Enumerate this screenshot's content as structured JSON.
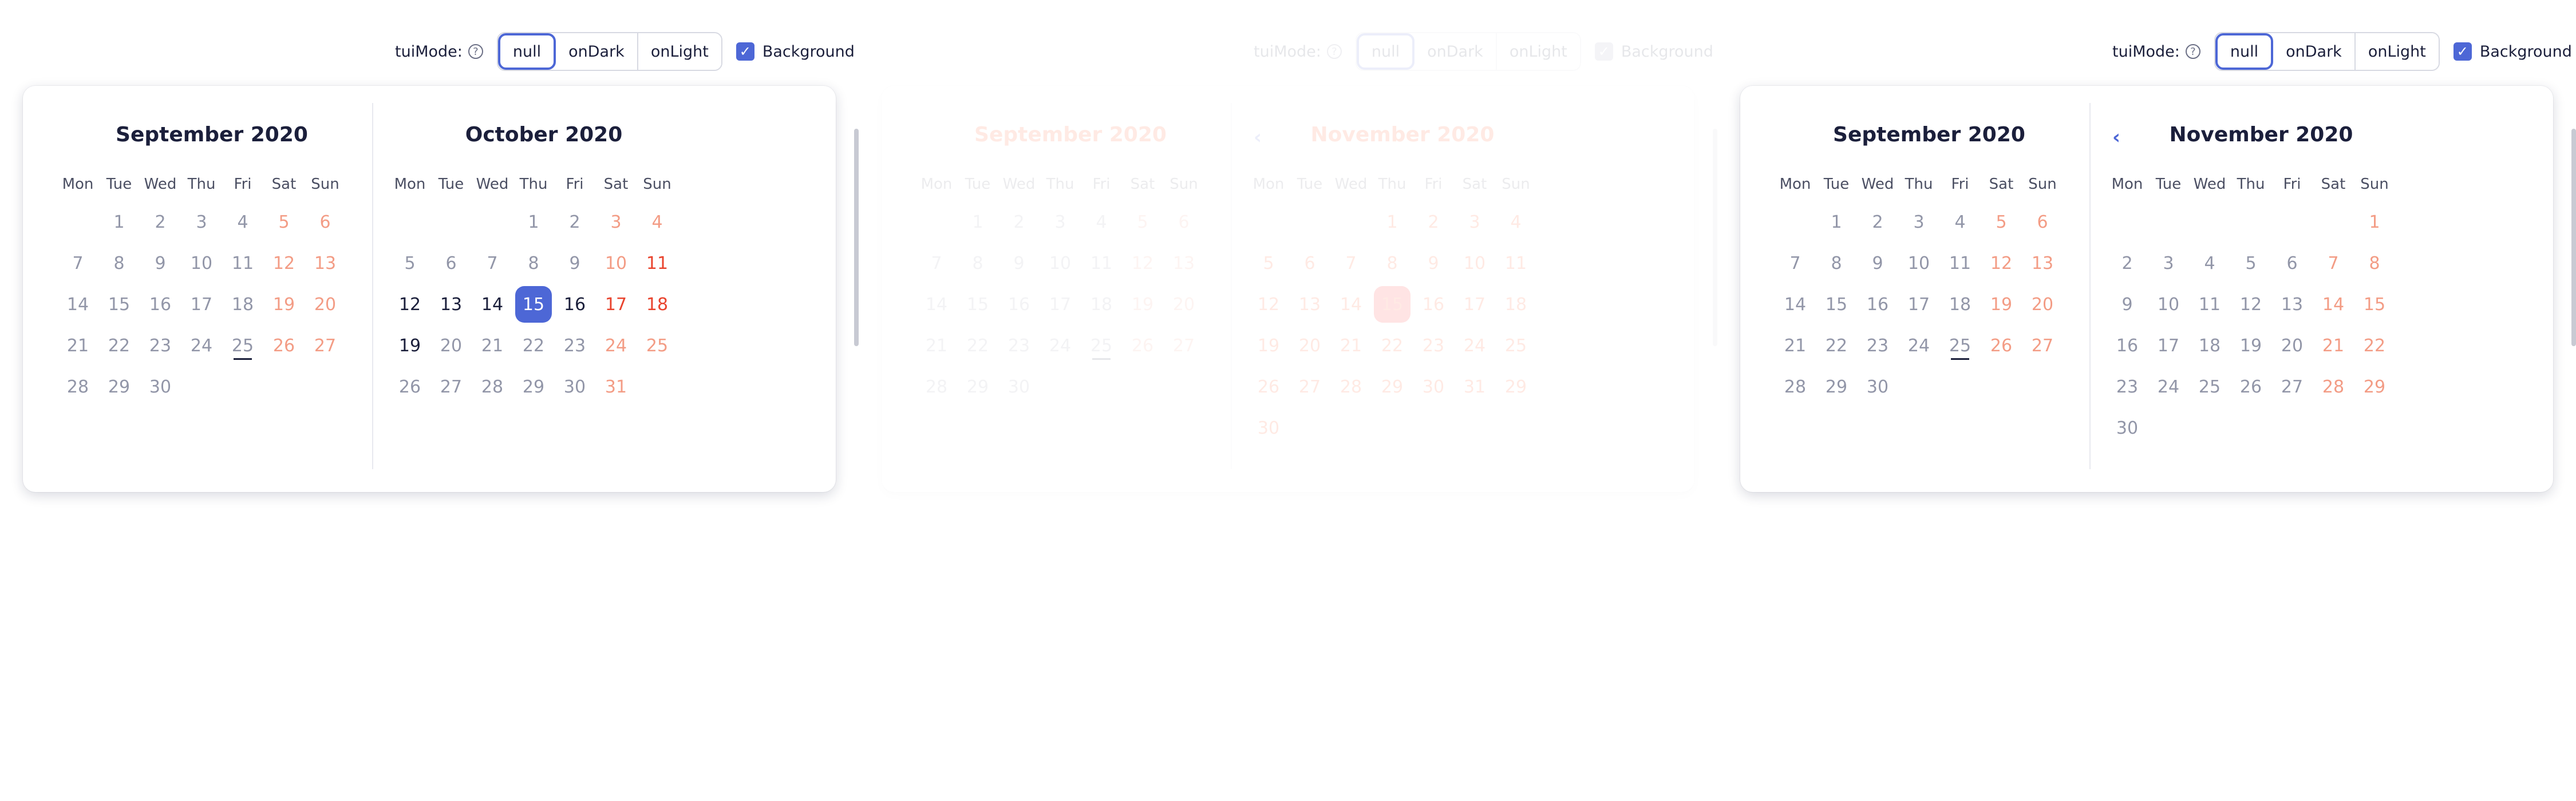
{
  "toolbar": {
    "mode_label": "tuiMode:",
    "help_icon": "question-circle-icon",
    "modes": [
      "null",
      "onDark",
      "onLight"
    ],
    "active_mode": "null",
    "background_label": "Background",
    "background_checked": true
  },
  "weekdays": [
    "Mon",
    "Tue",
    "Wed",
    "Thu",
    "Fri",
    "Sat",
    "Sun"
  ],
  "colors": {
    "accent": "#4d67d6",
    "weekend": "#f39c85",
    "weekend_strong": "#e9442e",
    "text": "#1b1f3b",
    "muted": "#9296a8",
    "onlight_accent": "#ff0000"
  },
  "panels": [
    {
      "left_month": {
        "title": "September 2020",
        "weeks": [
          [
            "",
            "1",
            "2",
            "3",
            "4",
            "5",
            "6"
          ],
          [
            "7",
            "8",
            "9",
            "10",
            "11",
            "12",
            "13"
          ],
          [
            "14",
            "15",
            "16",
            "17",
            "18",
            "19",
            "20"
          ],
          [
            "21",
            "22",
            "23",
            "24",
            "25",
            "26",
            "27"
          ],
          [
            "28",
            "29",
            "30",
            "",
            "",
            "",
            ""
          ]
        ],
        "today": "25"
      },
      "right_month": {
        "title": "October 2020",
        "weeks": [
          [
            "",
            "",
            "",
            "1",
            "2",
            "3",
            "4"
          ],
          [
            "5",
            "6",
            "7",
            "8",
            "9",
            "10",
            "11"
          ],
          [
            "12",
            "13",
            "14",
            "15",
            "16",
            "17",
            "18"
          ],
          [
            "19",
            "20",
            "21",
            "22",
            "23",
            "24",
            "25"
          ],
          [
            "26",
            "27",
            "28",
            "29",
            "30",
            "31",
            ""
          ]
        ],
        "selected": "15",
        "strong_days": [
          "11",
          "12",
          "13",
          "14",
          "15",
          "16",
          "17",
          "18",
          "19"
        ]
      }
    },
    {
      "left_month": {
        "title": "September 2020",
        "weeks": [
          [
            "",
            "1",
            "2",
            "3",
            "4",
            "5",
            "6"
          ],
          [
            "7",
            "8",
            "9",
            "10",
            "11",
            "12",
            "13"
          ],
          [
            "14",
            "15",
            "16",
            "17",
            "18",
            "19",
            "20"
          ],
          [
            "21",
            "22",
            "23",
            "24",
            "25",
            "26",
            "27"
          ],
          [
            "28",
            "29",
            "30",
            "",
            "",
            "",
            ""
          ]
        ],
        "today": "25"
      },
      "right_month": {
        "title": "November 2020",
        "weeks": [
          [
            "",
            "",
            "",
            "1",
            "2",
            "3",
            "4"
          ],
          [
            "5",
            "6",
            "7",
            "8",
            "9",
            "10",
            "11"
          ],
          [
            "12",
            "13",
            "14",
            "15",
            "16",
            "17",
            "18"
          ],
          [
            "19",
            "20",
            "21",
            "22",
            "23",
            "24",
            "25"
          ],
          [
            "26",
            "27",
            "28",
            "29",
            "30",
            "31",
            "29"
          ],
          [
            "30",
            "",
            "",
            "",
            "",
            "",
            ""
          ]
        ],
        "selected": "15",
        "all_strong": true
      }
    },
    {
      "left_month": {
        "title": "September 2020",
        "weeks": [
          [
            "",
            "1",
            "2",
            "3",
            "4",
            "5",
            "6"
          ],
          [
            "7",
            "8",
            "9",
            "10",
            "11",
            "12",
            "13"
          ],
          [
            "14",
            "15",
            "16",
            "17",
            "18",
            "19",
            "20"
          ],
          [
            "21",
            "22",
            "23",
            "24",
            "25",
            "26",
            "27"
          ],
          [
            "28",
            "29",
            "30",
            "",
            "",
            "",
            ""
          ]
        ],
        "today": "25"
      },
      "right_month": {
        "title": "November 2020",
        "weeks": [
          [
            "",
            "",
            "",
            "",
            "",
            "",
            "1"
          ],
          [
            "2",
            "3",
            "4",
            "5",
            "6",
            "7",
            "8"
          ],
          [
            "9",
            "10",
            "11",
            "12",
            "13",
            "14",
            "15"
          ],
          [
            "16",
            "17",
            "18",
            "19",
            "20",
            "21",
            "22"
          ],
          [
            "23",
            "24",
            "25",
            "26",
            "27",
            "28",
            "29"
          ],
          [
            "30",
            "",
            "",
            "",
            "",
            "",
            ""
          ]
        ]
      }
    }
  ]
}
